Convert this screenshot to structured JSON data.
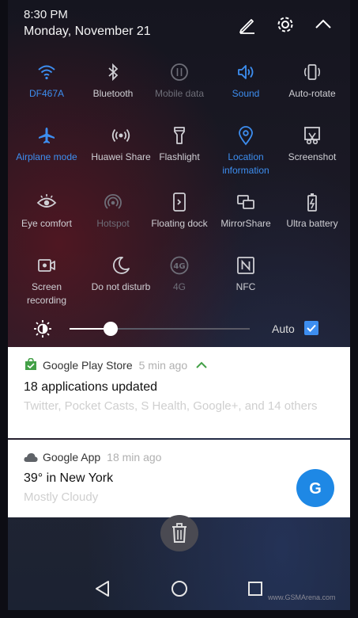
{
  "status": {
    "time": "8:30 PM",
    "date": "Monday, November 21"
  },
  "top_icons": [
    "edit-icon",
    "settings-icon",
    "collapse-icon"
  ],
  "quick_settings": [
    {
      "label": "DF467A",
      "icon": "wifi-icon",
      "state": "on"
    },
    {
      "label": "Bluetooth",
      "icon": "bluetooth-icon",
      "state": "off"
    },
    {
      "label": "Mobile data",
      "icon": "mobile-data-icon",
      "state": "disabled"
    },
    {
      "label": "Sound",
      "icon": "sound-icon",
      "state": "on"
    },
    {
      "label": "Auto-rotate",
      "icon": "auto-rotate-icon",
      "state": "off"
    },
    {
      "label": "Airplane mode",
      "icon": "airplane-icon",
      "state": "on"
    },
    {
      "label": "Huawei Share",
      "icon": "huawei-share-icon",
      "state": "off"
    },
    {
      "label": "Flashlight",
      "icon": "flashlight-icon",
      "state": "off"
    },
    {
      "label": "Location information",
      "icon": "location-icon",
      "state": "on"
    },
    {
      "label": "Screenshot",
      "icon": "screenshot-icon",
      "state": "off"
    },
    {
      "label": "Eye comfort",
      "icon": "eye-icon",
      "state": "off"
    },
    {
      "label": "Hotspot",
      "icon": "hotspot-icon",
      "state": "disabled"
    },
    {
      "label": "Floating dock",
      "icon": "floating-dock-icon",
      "state": "off"
    },
    {
      "label": "MirrorShare",
      "icon": "mirrorshare-icon",
      "state": "off"
    },
    {
      "label": "Ultra battery",
      "icon": "battery-icon",
      "state": "off"
    },
    {
      "label": "Screen recording",
      "icon": "screen-recording-icon",
      "state": "off"
    },
    {
      "label": "Do not disturb",
      "icon": "moon-icon",
      "state": "off"
    },
    {
      "label": "4G",
      "icon": "4g-icon",
      "state": "disabled"
    },
    {
      "label": "NFC",
      "icon": "nfc-icon",
      "state": "off"
    }
  ],
  "brightness": {
    "level": 0.23,
    "auto_label": "Auto",
    "auto_checked": true
  },
  "notifications": [
    {
      "app": "Google Play Store",
      "time_ago": "5 min ago",
      "title": "18 applications updated",
      "text": "Twitter, Pocket Casts, S Health, Google+, and 14 others"
    },
    {
      "app": "Google App",
      "time_ago": "18 min ago",
      "title": "39° in New York",
      "text": "Mostly Cloudy",
      "action_label": "G"
    }
  ],
  "watermark": "www.GSMArena.com",
  "colors": {
    "accent": "#3d8ef0",
    "panel_bg": "#1a1a24",
    "g_button": "#1e88e5"
  }
}
